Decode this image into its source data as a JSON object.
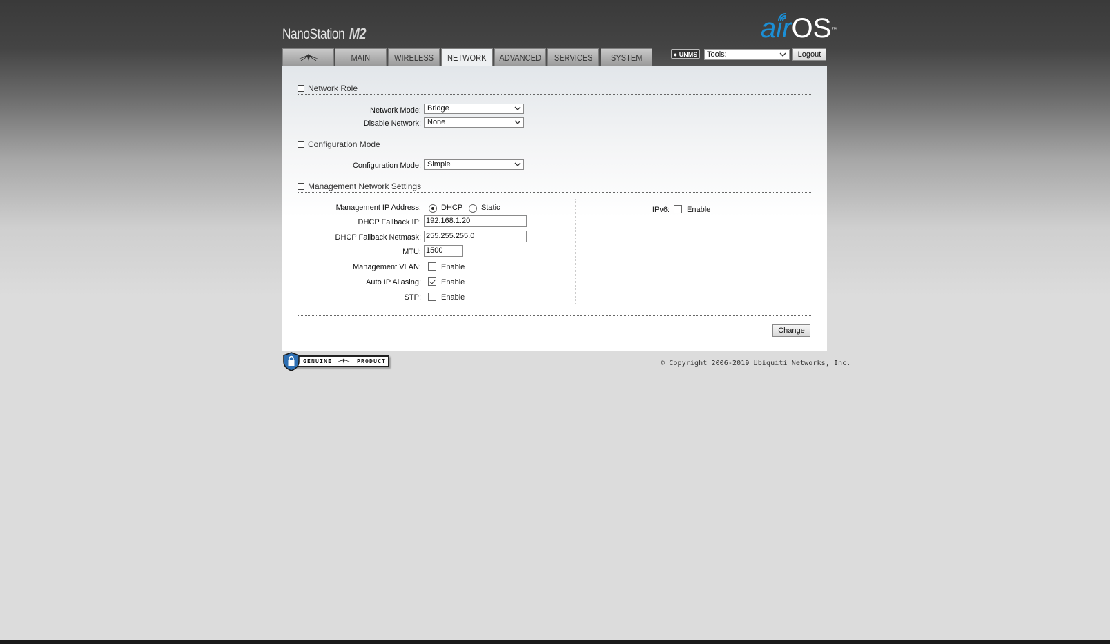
{
  "header": {
    "product_name": "NanoStation",
    "product_model": "M2",
    "os_brand_air": "air",
    "os_brand_os": "OS",
    "os_brand_tm": "™"
  },
  "tabs": [
    {
      "label": "",
      "icon": "ubiquiti-logo-icon",
      "active": false
    },
    {
      "label": "MAIN",
      "active": false
    },
    {
      "label": "WIRELESS",
      "active": false
    },
    {
      "label": "NETWORK",
      "active": true
    },
    {
      "label": "ADVANCED",
      "active": false
    },
    {
      "label": "SERVICES",
      "active": false
    },
    {
      "label": "SYSTEM",
      "active": false
    }
  ],
  "toolbar": {
    "unms_badge": "UNMS",
    "tools_select": "Tools:",
    "logout_label": "Logout"
  },
  "network_role": {
    "title": "Network Role",
    "network_mode_label": "Network Mode:",
    "network_mode_value": "Bridge",
    "disable_network_label": "Disable Network:",
    "disable_network_value": "None"
  },
  "configuration_mode": {
    "title": "Configuration Mode",
    "label": "Configuration Mode:",
    "value": "Simple"
  },
  "management": {
    "title": "Management Network Settings",
    "ip_address_label": "Management IP Address:",
    "dhcp_label": "DHCP",
    "static_label": "Static",
    "ip_mode": "DHCP",
    "fallback_ip_label": "DHCP Fallback IP:",
    "fallback_ip_value": "192.168.1.20",
    "fallback_netmask_label": "DHCP Fallback Netmask:",
    "fallback_netmask_value": "255.255.255.0",
    "mtu_label": "MTU:",
    "mtu_value": "1500",
    "vlan_label": "Management VLAN:",
    "vlan_enable": "Enable",
    "vlan_checked": false,
    "auto_ip_label": "Auto IP Aliasing:",
    "auto_ip_enable": "Enable",
    "auto_ip_checked": true,
    "stp_label": "STP:",
    "stp_enable": "Enable",
    "stp_checked": false,
    "ipv6_label": "IPv6:",
    "ipv6_enable": "Enable",
    "ipv6_checked": false
  },
  "actions": {
    "change_label": "Change"
  },
  "footer": {
    "genuine_word1": "GENUINE",
    "genuine_word2": "PRODUCT",
    "copyright": "© Copyright 2006-2019 Ubiquiti Networks, Inc."
  }
}
